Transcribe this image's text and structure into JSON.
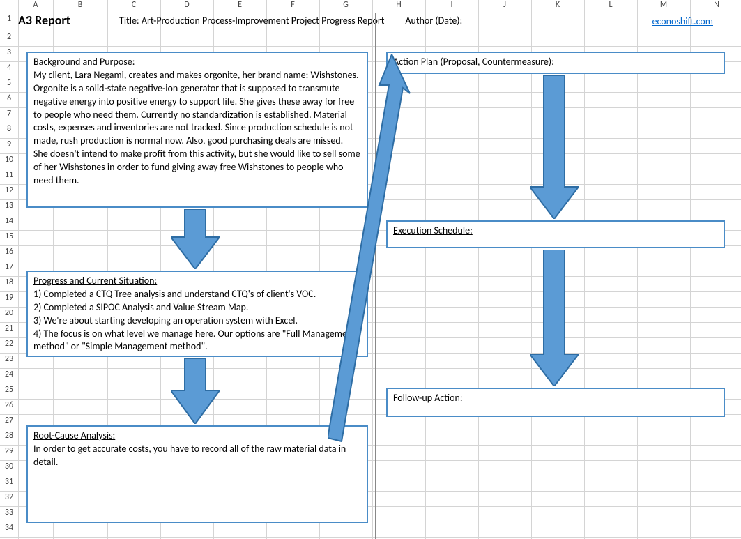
{
  "header": {
    "report_label": "A3 Report",
    "title_prefix": "Title: ",
    "title_text": "Art-Production Process-Improvement Project Progress Report",
    "author_prefix": "Author (Date):",
    "link_text": "econoshift.com"
  },
  "columns": [
    "A",
    "B",
    "C",
    "D",
    "E",
    "F",
    "G",
    "H",
    "I",
    "J",
    "K",
    "L",
    "M",
    "N"
  ],
  "rows": [
    "1",
    "2",
    "3",
    "4",
    "5",
    "6",
    "7",
    "8",
    "9",
    "10",
    "11",
    "12",
    "13",
    "14",
    "15",
    "16",
    "17",
    "18",
    "19",
    "20",
    "21",
    "22",
    "23",
    "24",
    "25",
    "26",
    "27",
    "28",
    "29",
    "30",
    "31",
    "32",
    "33",
    "34"
  ],
  "boxes": {
    "background": {
      "heading": "Background and Purpose:",
      "body": "My client, Lara Negami, creates and makes orgonite, her brand name: Wishstones.  Orgonite is a solid-state negative-ion generator that is supposed to transmute negative energy into positive energy to support life. She gives these away for free to people who need them.  Currently no standardization is established.  Material costs, expenses and inventories are not tracked.  Since production schedule is not made, rush production is normal now.  Also, good purchasing deals are missed.\nShe doesn't intend to make profit from this activity, but she would like to sell some of her Wishstones in order to fund giving away free Wishstones to people who need them."
    },
    "progress": {
      "heading": "Progress and Current Situation:",
      "body": "1) Completed a CTQ Tree analysis and understand CTQ's of client's VOC.\n2) Completed a SIPOC Analysis and Value Stream Map.\n3) We're about starting developing an operation system with Excel.\n4) The focus is on what level we manage here.  Our options are \"Full Management method\" or \"Simple Management method\"."
    },
    "rootcause": {
      "heading": "Root-Cause Analysis:",
      "body": "In order to get accurate costs, you have to record all of the raw material data in detail."
    },
    "action": {
      "heading": "Action Plan (Proposal, Countermeasure):",
      "body": ""
    },
    "schedule": {
      "heading": "Execution Schedule:",
      "body": ""
    },
    "followup": {
      "heading": "Follow-up Action:",
      "body": ""
    }
  },
  "colors": {
    "box_border": "#4a8cc7",
    "arrow_fill": "#5b9bd5",
    "arrow_stroke": "#2e6da4"
  }
}
